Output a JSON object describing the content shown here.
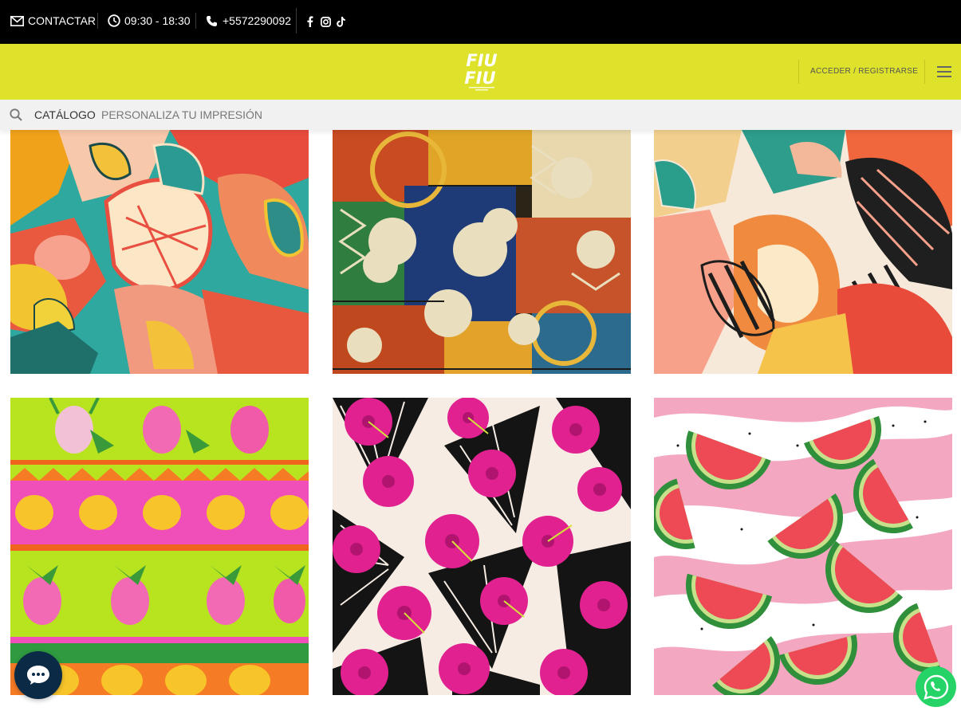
{
  "topbar": {
    "contact_label": "CONTACTAR",
    "hours": "09:30 - 18:30",
    "phone": "+5572290092",
    "social_icons": [
      "facebook-icon",
      "instagram-icon",
      "tiktok-icon"
    ]
  },
  "header": {
    "brand_line1": "FIU",
    "brand_line2": "FIU",
    "login_label": "ACCEDER / REGISTRARSE",
    "background_color": "#dfe22a"
  },
  "nav": {
    "items": [
      {
        "label": "CATÁLOGO",
        "active": true
      },
      {
        "label": "PERSONALIZA TU IMPRESIÓN",
        "active": false
      }
    ]
  },
  "products": [
    {
      "pattern": "tropical leaves teal coral yellow"
    },
    {
      "pattern": "hibiscus tribal patchwork"
    },
    {
      "pattern": "monstera coral tiger stripes"
    },
    {
      "pattern": "pineapple and palm stripes"
    },
    {
      "pattern": "pink hibiscus on black palms"
    },
    {
      "pattern": "watermelon slices pink stripes"
    }
  ],
  "floating": {
    "chat_icon": "chat-bubble-icon",
    "whatsapp_icon": "whatsapp-icon"
  }
}
